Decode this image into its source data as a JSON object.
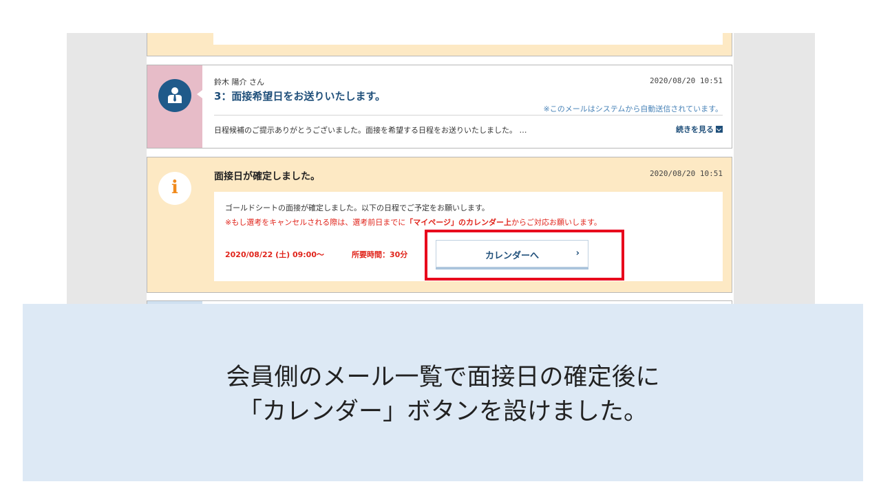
{
  "messages": [
    {
      "sender": "鈴木 陽介 さん",
      "subject": "3：面接希望日をお送りいたします。",
      "date": "2020/08/20 10:51",
      "auto_note": "※このメールはシステムから自動送信されています。",
      "excerpt": "日程候補のご提示ありがとうございました。面接を希望する日程をお送りいたしました。 …",
      "more_label": "続きを見る",
      "icon": "user-avatar-icon"
    }
  ],
  "notice": {
    "title": "面接日が確定しました。",
    "date": "2020/08/20 10:51",
    "line1": "ゴールドシートの面接が確定しました。以下の日程でご予定をお願いします。",
    "line2_prefix": "※もし選考をキャンセルされる際は、選考前日までに",
    "line2_bold": "「マイページ」のカレンダー上",
    "line2_suffix": "からご対応お願いします。",
    "schedule": "2020/08/22 (土) 09:00〜",
    "duration": "所要時間：30分",
    "calendar_button_label": "カレンダーへ",
    "calendar_button_chevron": "›",
    "icon": "info-icon",
    "icon_glyph": "i"
  },
  "caption": {
    "line1": "会員側のメール一覧で面接日の確定後に",
    "line2": "「カレンダー」ボタンを設けました。"
  },
  "colors": {
    "accent_blue": "#1f4f7a",
    "notice_bg": "#fde9c4",
    "warning_red": "#e0241b",
    "highlight_red": "#e8001c",
    "caption_bg": "#dde9f5"
  }
}
